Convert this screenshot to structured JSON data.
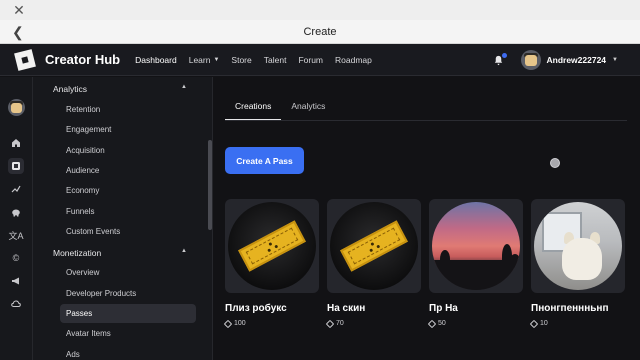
{
  "browser": {
    "title": "Create"
  },
  "header": {
    "brand": "Creator Hub",
    "nav": [
      {
        "label": "Dashboard"
      },
      {
        "label": "Learn"
      },
      {
        "label": "Store"
      },
      {
        "label": "Talent"
      },
      {
        "label": "Forum"
      },
      {
        "label": "Roadmap"
      }
    ],
    "username": "Andrew222724"
  },
  "sidebar": {
    "analytics": {
      "title": "Analytics",
      "items": [
        "Retention",
        "Engagement",
        "Acquisition",
        "Audience",
        "Economy",
        "Funnels",
        "Custom Events"
      ]
    },
    "monetization": {
      "title": "Monetization",
      "items": [
        "Overview",
        "Developer Products",
        "Passes",
        "Avatar Items",
        "Ads"
      ]
    }
  },
  "main": {
    "tabs": [
      {
        "label": "Creations"
      },
      {
        "label": "Analytics"
      }
    ],
    "create_button": "Create A Pass",
    "passes": [
      {
        "name": "Плиз робукс",
        "price": "100"
      },
      {
        "name": "На скин",
        "price": "70"
      },
      {
        "name": "Пр На",
        "price": "50"
      },
      {
        "name": "Пнонгпеннньнп",
        "price": "10"
      }
    ]
  }
}
